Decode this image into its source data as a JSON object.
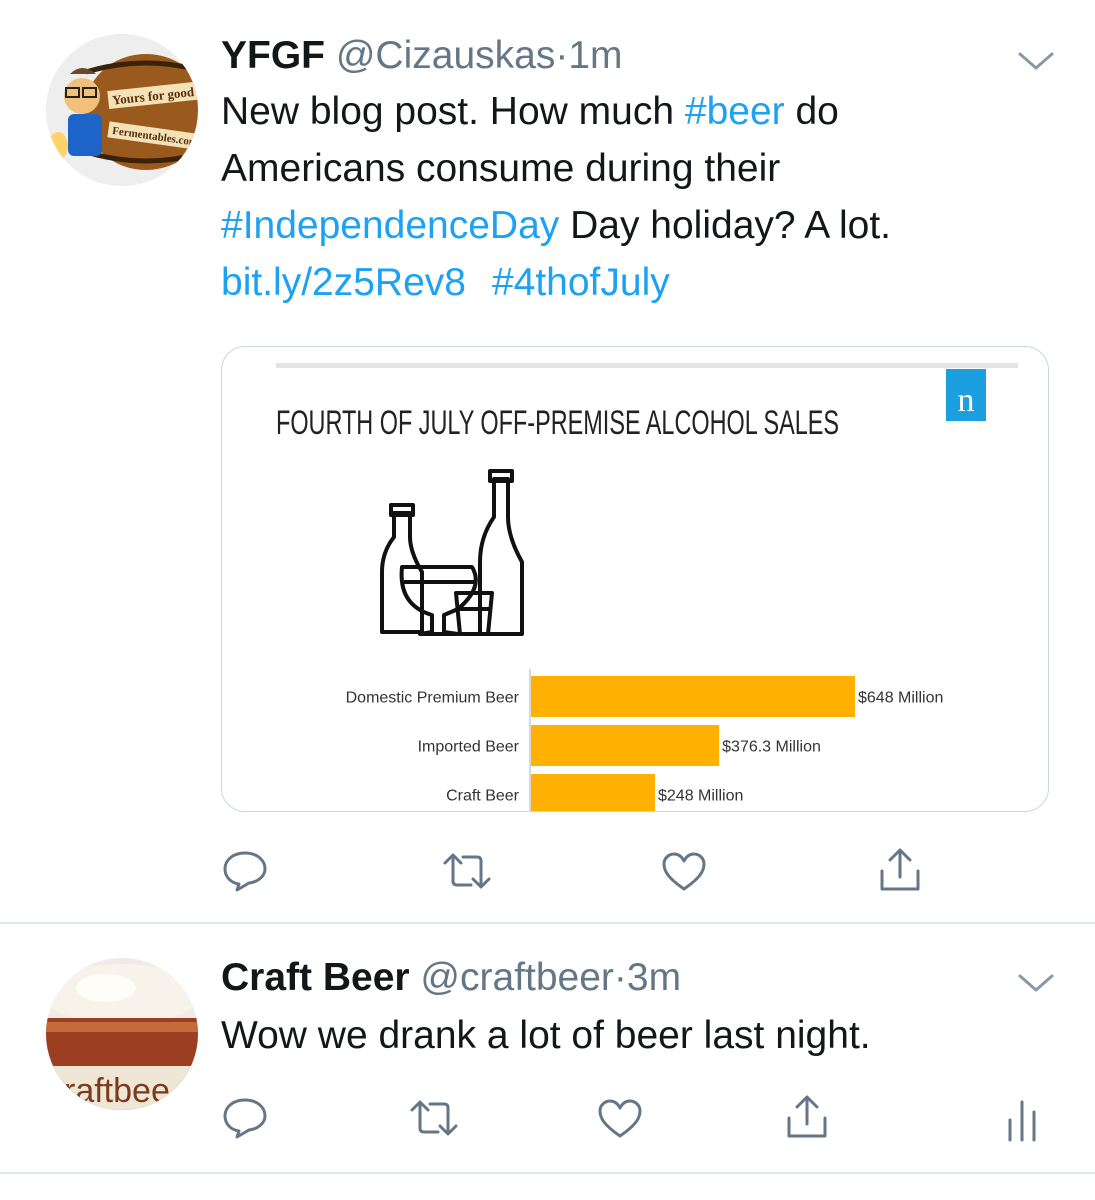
{
  "tweets": [
    {
      "name": "YFGF",
      "handle": "@Cizauskas",
      "sep": "·",
      "time": "1m",
      "avatar": {
        "text_top": "Yours for good",
        "text_bottom": "Fermentables.com"
      },
      "text": {
        "l1a": "New blog post. How much ",
        "l1b": "#beer",
        "l1c": " do",
        "l2": "Americans consume during their",
        "l3a": "#IndependenceDay",
        "l3b": " Day holiday? A lot.",
        "l4a": "bit.ly/2z5Rev8",
        "l4b": "#4thofJuly"
      },
      "card": {
        "badge": "n",
        "badge_color": "#1c9fe0",
        "title": "FOURTH OF JULY OFF-PREMISE ALCOHOL SALES",
        "icon": "alcohol-bottles-icon",
        "chart_data": {
          "type": "bar",
          "orientation": "horizontal",
          "title": "FOURTH OF JULY OFF-PREMISE ALCOHOL SALES",
          "categories": [
            "Domestic Premium Beer",
            "Imported Beer",
            "Craft Beer"
          ],
          "values": [
            648,
            376.3,
            248
          ],
          "value_labels": [
            "$648 Million",
            "$376.3 Million",
            "$248 Million"
          ],
          "units": "Million USD",
          "bar_color": "#ffb000",
          "xlim": [
            0,
            780
          ]
        }
      },
      "actions": [
        "reply-icon",
        "retweet-icon",
        "like-icon",
        "share-icon"
      ]
    },
    {
      "name": "Craft Beer",
      "handle": "@craftbeer",
      "sep": "·",
      "time": "3m",
      "avatar": {
        "text": "raftbee"
      },
      "text": {
        "l1": "Wow we drank a lot of beer last night."
      },
      "actions": [
        "reply-icon",
        "retweet-icon",
        "like-icon",
        "share-icon",
        "analytics-icon"
      ]
    }
  ],
  "colors": {
    "link": "#1da1f2",
    "muted": "#657786",
    "icon": "#657786"
  }
}
